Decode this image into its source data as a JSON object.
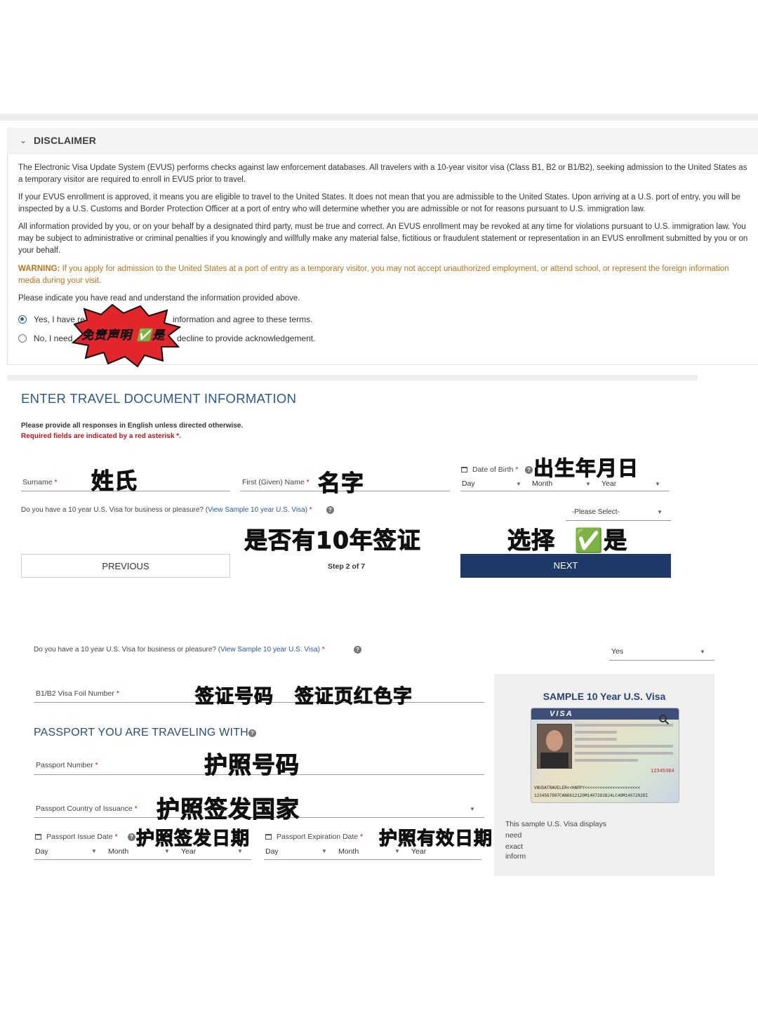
{
  "disclaimer": {
    "title": "DISCLAIMER",
    "p1": "The Electronic Visa Update System (EVUS) performs checks against law enforcement databases. All travelers with a 10-year visitor visa (Class B1, B2 or B1/B2), seeking admission to the United States as a temporary visitor are required to enroll in EVUS prior to travel.",
    "p2": "If your EVUS enrollment is approved, it means you are eligible to travel to the United States. It does not mean that you are admissible to the United States. Upon arriving at a U.S. port of entry, you will be inspected by a U.S. Customs and Border Protection Officer at a port of entry who will determine whether you are admissible or not for reasons pursuant to U.S. immigration law.",
    "p3": "All information provided by you, or on your behalf by a designated third party, must be true and correct. An EVUS enrollment may be revoked at any time for violations pursuant to U.S. immigration law. You may be subject to administrative or criminal penalties if you knowingly and willfully make any material false, fictitious or fraudulent statement or representation in an EVUS enrollment submitted by you or on your behalf.",
    "warning_label": "WARNING:",
    "warning_text": " If you apply for admission to the United States at a port of entry as a temporary visitor, you may not accept unauthorized employment, or attend school, or represent the foreign information media during your visit.",
    "prompt": "Please indicate you have read and understand the information provided above.",
    "yes_label_a": "Yes, I have re",
    "yes_label_b": "information and agree to these terms.",
    "no_label_a": "No, I need",
    "no_label_b": "decline to provide acknowledgement.",
    "yes_selected": true,
    "stamp_text": "免责声明 ✅是"
  },
  "travel": {
    "heading": "ENTER TRAVEL DOCUMENT INFORMATION",
    "note1": "Please provide all responses in English unless directed otherwise.",
    "note2": "Required fields are indicated by a red asterisk *.",
    "surname_label": "Surname",
    "given_label": "First (Given) Name",
    "dob_label": "Date of Birth",
    "day": "Day",
    "month": "Month",
    "year": "Year",
    "visa_q": "Do you have a 10 year U.S. Visa for business or pleasure?",
    "visa_link": "(View Sample 10 year U.S. Visa)",
    "please_select": "-Please Select-",
    "prev_btn": "PREVIOUS",
    "next_btn": "NEXT",
    "step": "Step 2 of 7",
    "asterisk": "*"
  },
  "annotations": {
    "surname": "姓氏",
    "given": "名字",
    "dob": "出生年月日",
    "visa_q": "是否有10年签证",
    "choose": "选择",
    "yes": "✅是",
    "foil": "签证号码",
    "foil_red": "签证页红色字",
    "passport_no": "护照号码",
    "country": "护照签发国家",
    "issue": "护照签发日期",
    "expiry": "护照有效日期"
  },
  "passport_section": {
    "visa_q": "Do you have a 10 year U.S. Visa for business or pleasure?",
    "visa_link": "(View Sample 10 year U.S. Visa)",
    "visa_answer": "Yes",
    "foil_label": "B1/B2 Visa Foil Number",
    "heading": "PASSPORT YOU ARE TRAVELING WITH",
    "passport_no_label": "Passport Number",
    "country_label": "Passport Country of Issuance",
    "issue_label": "Passport Issue Date",
    "expiry_label": "Passport Expiration Date",
    "day": "Day",
    "month": "Month",
    "year": "Year"
  },
  "sample_panel": {
    "title": "SAMPLE 10 Year U.S. Visa",
    "visa_word": "VISA",
    "caption_1": "This sample U.S. Visa displays",
    "caption_2": "need",
    "caption_3": "exact",
    "caption_4": "inform",
    "mrz1": "VNUSATRAVELER<<HAPPY<<<<<<<<<<<<<<<<<<<<<<",
    "mrz2": "1234567897CAN6612120M1407282BJ4LC40M1407282DI",
    "foil_red": "12345364"
  },
  "colors": {
    "accent_blue": "#1f3a68",
    "heading_blue": "#2b5a82",
    "warning": "#b8741a",
    "required_red": "#c0141c",
    "stamp_red": "#e3262b"
  }
}
